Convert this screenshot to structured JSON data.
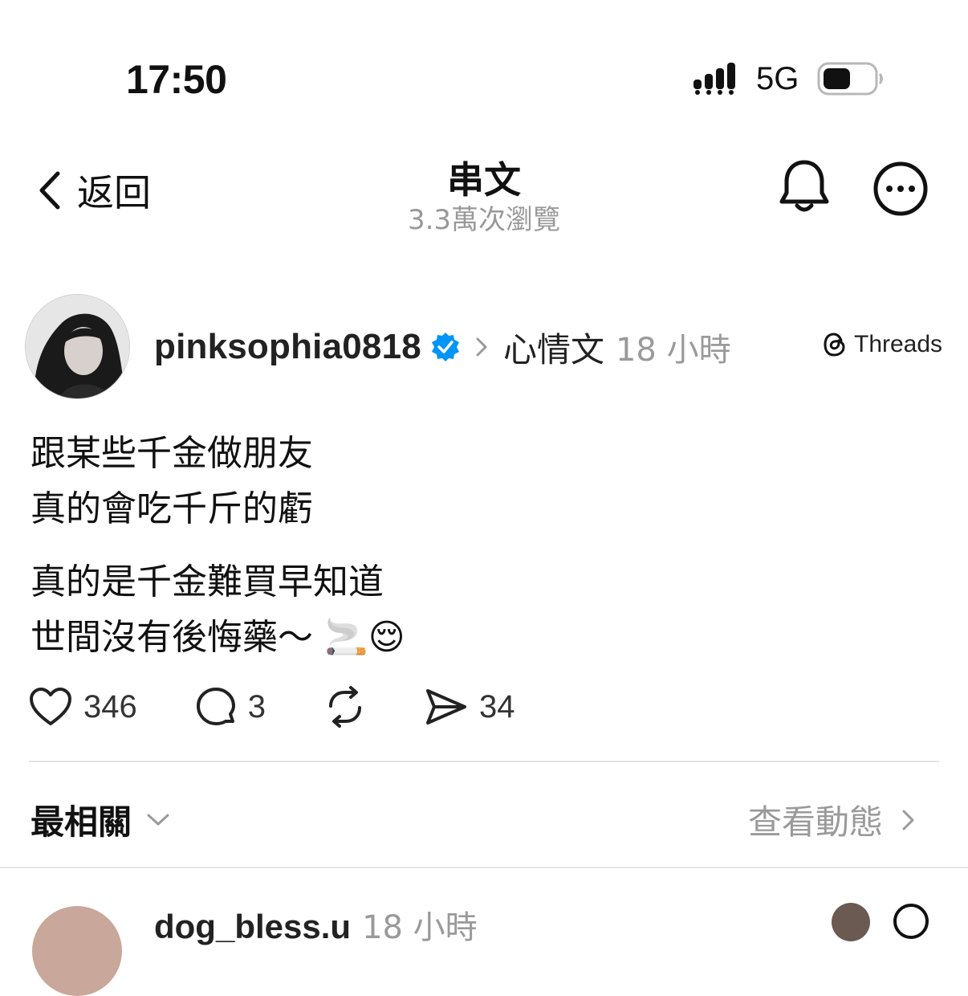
{
  "status_bar": {
    "time": "17:50",
    "network": "5G",
    "battery_level": 0.55
  },
  "nav": {
    "back_label": "返回",
    "title": "串文",
    "views": "3.3萬次瀏覽"
  },
  "post": {
    "username": "pinksophia0818",
    "verified": true,
    "topic": "心情文",
    "time": "18 小時",
    "source": "Threads",
    "lines": [
      "跟某些千金做朋友",
      "真的會吃千斤的虧",
      "真的是千金難買早知道",
      "世間沒有後悔藥～ 🚬😌"
    ],
    "likes": "346",
    "comments": "3",
    "shares": "34"
  },
  "replies_header": {
    "sort_label": "最相關",
    "activity_label": "查看動態"
  },
  "next_reply": {
    "username": "dog_bless.u",
    "time": "18 小時"
  },
  "colors": {
    "text": "#111111",
    "muted": "#999999",
    "verified_blue": "#0095f6",
    "divider": "#e4e4e4"
  }
}
